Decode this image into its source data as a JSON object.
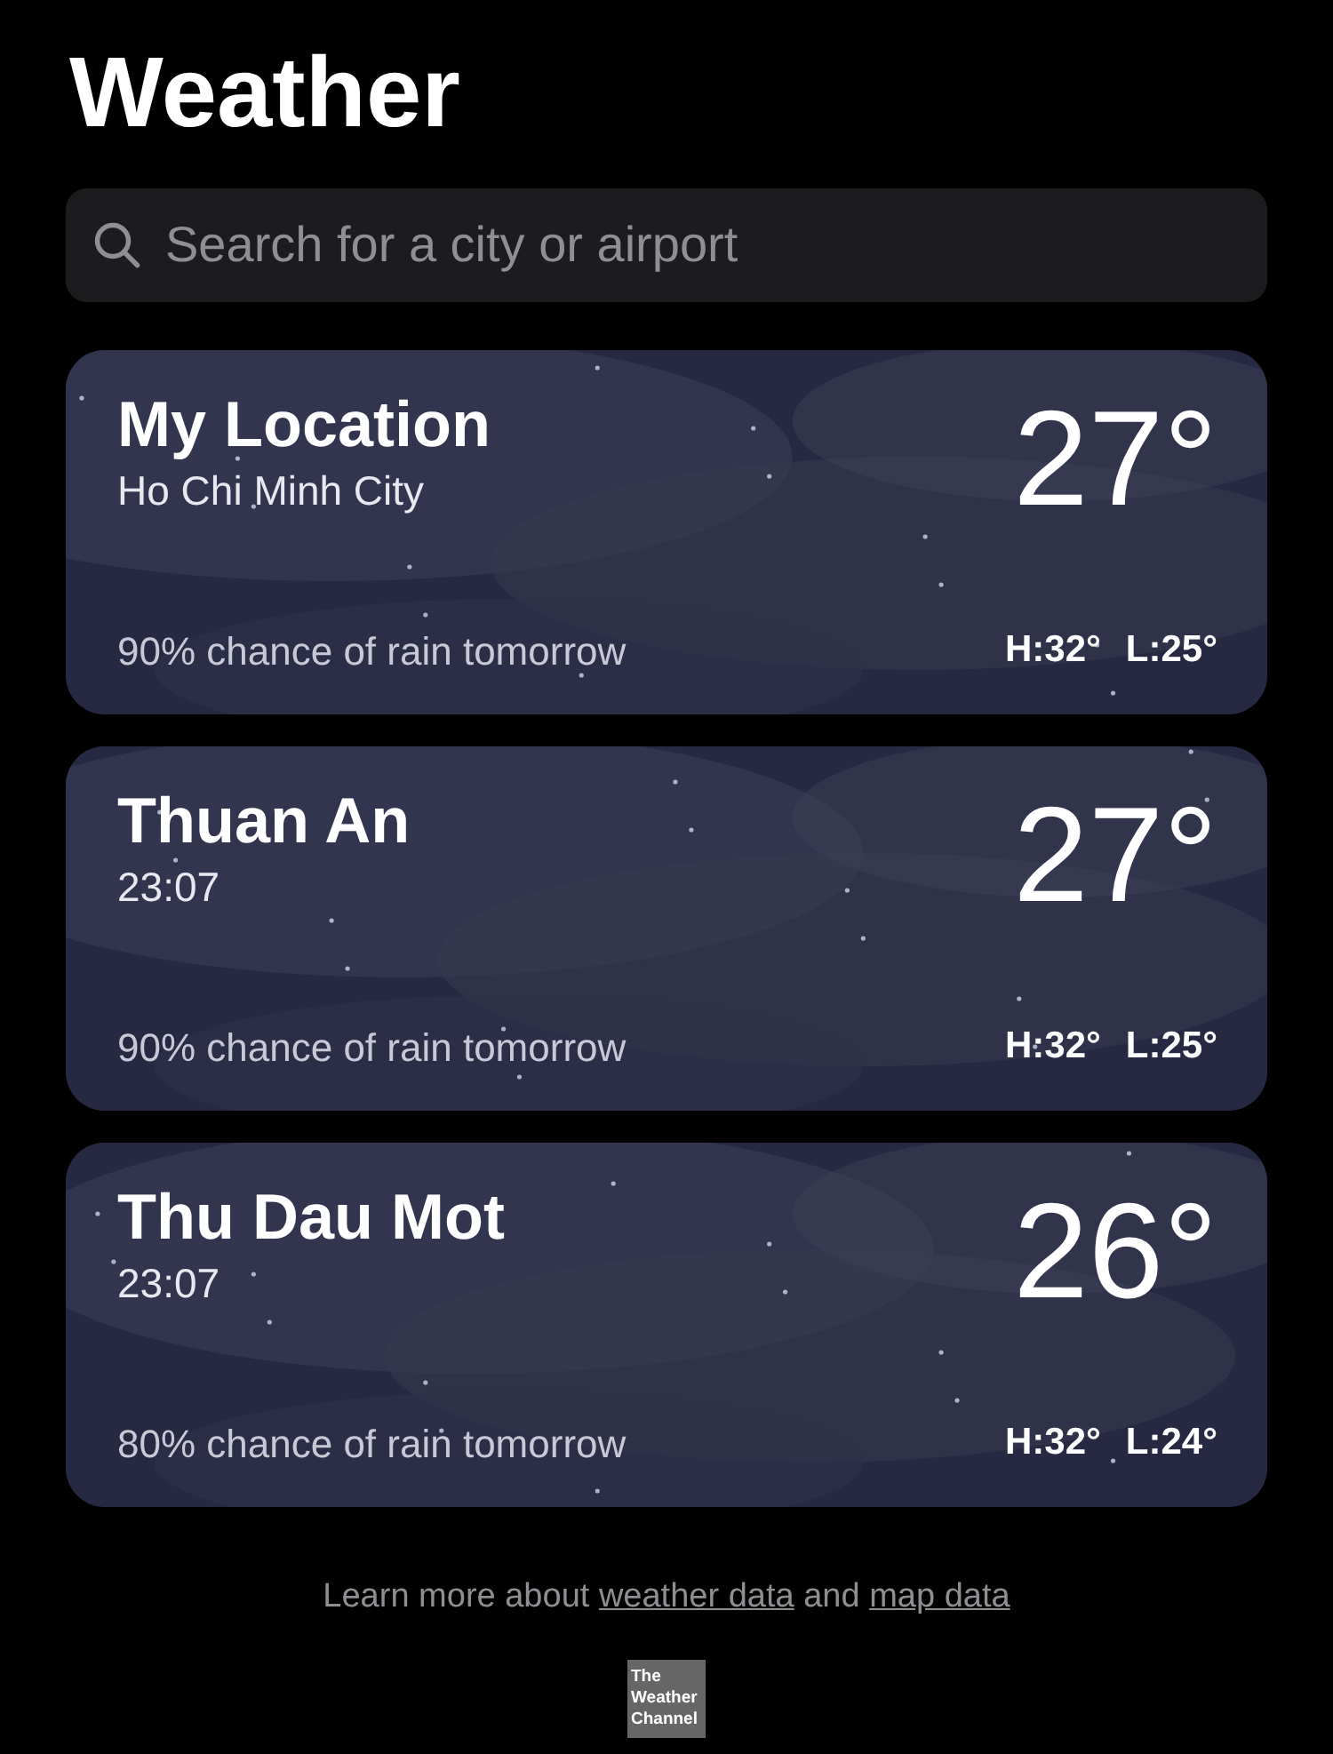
{
  "title": "Weather",
  "search": {
    "placeholder": "Search for a city or airport"
  },
  "cards": [
    {
      "name": "My Location",
      "subtitle": "Ho Chi Minh City",
      "temperature": "27°",
      "summary": "90% chance of rain tomorrow",
      "high": "H:32°",
      "low": "L:25°"
    },
    {
      "name": "Thuan An",
      "subtitle": "23:07",
      "temperature": "27°",
      "summary": "90% chance of rain tomorrow",
      "high": "H:32°",
      "low": "L:25°"
    },
    {
      "name": "Thu Dau Mot",
      "subtitle": "23:07",
      "temperature": "26°",
      "summary": "80% chance of rain tomorrow",
      "high": "H:32°",
      "low": "L:24°"
    }
  ],
  "footer": {
    "before": "Learn more about",
    "link_1": "weather data",
    "middle": "and",
    "link_2": "map data"
  },
  "logo": {
    "lines": [
      "The",
      "Weather",
      "Channel"
    ]
  }
}
